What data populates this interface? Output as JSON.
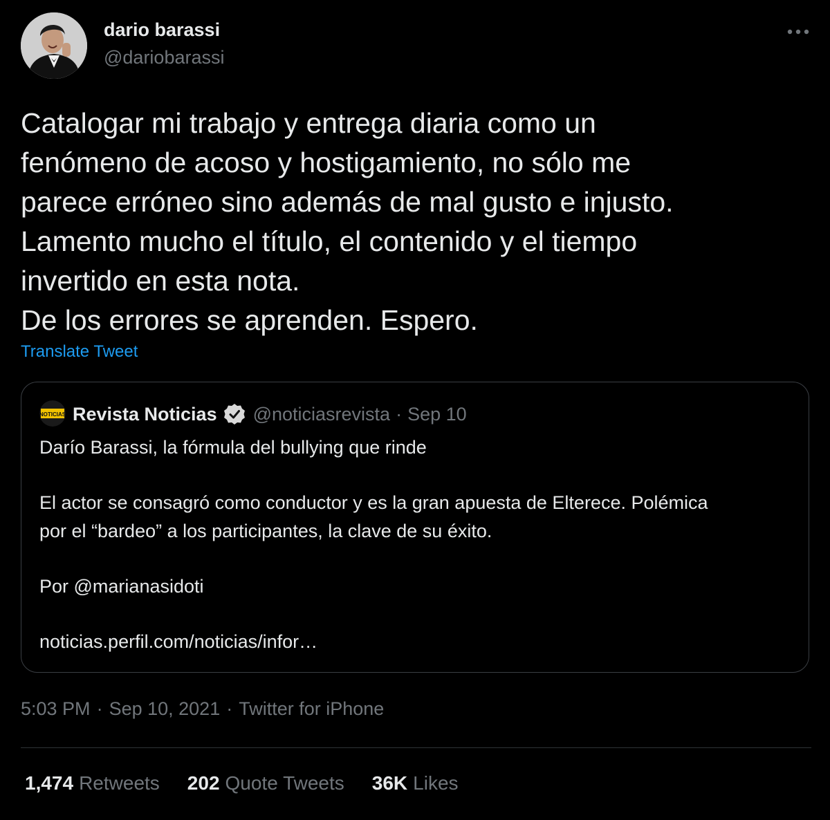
{
  "tweet": {
    "author": {
      "name": "dario barassi",
      "handle": "@dariobarassi"
    },
    "text_lines": [
      "Catalogar mi trabajo y entrega diaria como un",
      "fenómeno de acoso y hostigamiento, no sólo me",
      "parece erróneo sino además de mal gusto e injusto.",
      "Lamento mucho el título, el contenido y el tiempo",
      "invertido en esta nota.",
      "De los errores se aprenden. Espero."
    ],
    "translate_label": "Translate Tweet",
    "more_icon": "more-horizontal-icon",
    "quoted": {
      "avatar_text": "NOTICIAS",
      "name": "Revista Noticias",
      "verified_icon": "verified-badge-icon",
      "handle": "@noticiasrevista",
      "separator": "·",
      "date": "Sep 10",
      "lines": [
        "Darío Barassi, la fórmula del bullying que rinde",
        "",
        "El actor se consagró como conductor y es la gran apuesta de Elterece. Polémica",
        "por el “bardeo” a los participantes, la clave de su éxito.",
        "",
        "Por @marianasidoti",
        "",
        "noticias.perfil.com/noticias/infor…"
      ]
    },
    "meta": {
      "time": "5:03 PM",
      "separator": "·",
      "date": "Sep 10, 2021",
      "source": "Twitter for iPhone"
    },
    "stats": [
      {
        "count": "1,474",
        "label": "Retweets"
      },
      {
        "count": "202",
        "label": "Quote Tweets"
      },
      {
        "count": "36K",
        "label": "Likes"
      }
    ],
    "colors": {
      "background": "#000000",
      "text": "#e7e9ea",
      "muted": "#71767b",
      "accent": "#1d9bf0",
      "border": "#2f3336",
      "verified_badge": "#d9d9d9",
      "noticias_logo": "#f2c200"
    }
  }
}
